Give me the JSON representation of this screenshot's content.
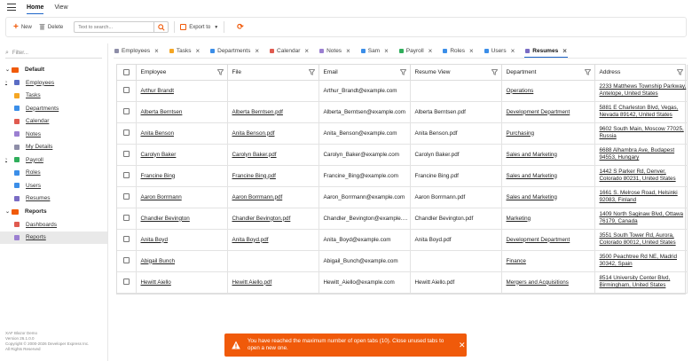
{
  "header": {
    "tabs": [
      {
        "label": "Home",
        "active": true
      },
      {
        "label": "View",
        "active": false
      }
    ]
  },
  "toolbar": {
    "new_label": "New",
    "delete_label": "Delete",
    "search_placeholder": "Text to search...",
    "export_label": "Export to"
  },
  "sidebar": {
    "filter_placeholder": "Filter...",
    "groups": [
      {
        "label": "Default"
      },
      {
        "label": "Reports"
      }
    ],
    "items": [
      {
        "label": "Employees",
        "color": "#5a6cc4",
        "expandable": true
      },
      {
        "label": "Tasks",
        "color": "#f5a623",
        "expandable": false
      },
      {
        "label": "Departments",
        "color": "#3b8ee8",
        "expandable": false
      },
      {
        "label": "Calendar",
        "color": "#e05a4f",
        "expandable": false
      },
      {
        "label": "Notes",
        "color": "#9b7fd1",
        "expandable": false
      },
      {
        "label": "My Details",
        "color": "#8e8ea8",
        "expandable": false
      },
      {
        "label": "Payroll",
        "color": "#2fae5b",
        "expandable": true
      },
      {
        "label": "Roles",
        "color": "#3b8ee8",
        "expandable": false
      },
      {
        "label": "Users",
        "color": "#3b8ee8",
        "expandable": false
      },
      {
        "label": "Resumes",
        "color": "#7a6cc4",
        "expandable": false
      }
    ],
    "report_items": [
      {
        "label": "Dashboards",
        "color": "#e05a4f"
      },
      {
        "label": "Reports",
        "color": "#9b7fd1"
      }
    ],
    "footer": [
      "XAF Blazor Demo",
      "Version 26.1.0.0",
      "Copyright © 2000-2026 Developer Express Inc.",
      "All Rights Reserved"
    ]
  },
  "tabs": [
    {
      "label": "Employees",
      "color": "#8e8ea8",
      "active": false
    },
    {
      "label": "Tasks",
      "color": "#f5a623",
      "active": false
    },
    {
      "label": "Departments",
      "color": "#3b8ee8",
      "active": false
    },
    {
      "label": "Calendar",
      "color": "#e05a4f",
      "active": false
    },
    {
      "label": "Notes",
      "color": "#9b7fd1",
      "active": false
    },
    {
      "label": "Sam",
      "color": "#3b8ee8",
      "active": false
    },
    {
      "label": "Payroll",
      "color": "#2fae5b",
      "active": false
    },
    {
      "label": "Roles",
      "color": "#3b8ee8",
      "active": false
    },
    {
      "label": "Users",
      "color": "#3b8ee8",
      "active": false
    },
    {
      "label": "Resumes",
      "color": "#7a6cc4",
      "active": true
    }
  ],
  "grid": {
    "columns": [
      "Employee",
      "File",
      "Email",
      "Resume View",
      "Department",
      "Address"
    ],
    "rows": [
      [
        "Arthur Brandt",
        "",
        "Arthur_Brandt@example.com",
        "",
        "Operations",
        "2233 Matthews Township Parkway, Antelope, United States"
      ],
      [
        "Alberta Berntsen",
        "Alberta Berntsen.pdf",
        "Alberta_Berntsen@example.com",
        "Alberta Berntsen.pdf",
        "Development Department",
        "5881 E Charleston Blvd, Vegas, Nevada 89142, United States"
      ],
      [
        "Anita Benson",
        "Anita Benson.pdf",
        "Anita_Benson@example.com",
        "Anita Benson.pdf",
        "Purchasing",
        "9602 South Main, Moscow 77025, Russia"
      ],
      [
        "Carolyn Baker",
        "Carolyn Baker.pdf",
        "Carolyn_Baker@example.com",
        "Carolyn Baker.pdf",
        "Sales and Marketing",
        "6688 Alhambra Ave, Budapest 94553, Hungary"
      ],
      [
        "Francine Bing",
        "Francine Bing.pdf",
        "Francine_Bing@example.com",
        "Francine Bing.pdf",
        "Sales and Marketing",
        "1442 S Parker Rd, Denver, Colorado 80231, United States"
      ],
      [
        "Aaron Borrmann",
        "Aaron Borrmann.pdf",
        "Aaron_Borrmann@example.com",
        "Aaron Borrmann.pdf",
        "Sales and Marketing",
        "1661 S. Melrose Road, Helsinki 92083, Finland"
      ],
      [
        "Chandler Bevington",
        "Chandler Bevington.pdf",
        "Chandler_Bevington@example.com",
        "Chandler Bevington.pdf",
        "Marketing",
        "1409 North Saginaw Blvd, Ottawa 76179, Canada"
      ],
      [
        "Anita Boyd",
        "Anita Boyd.pdf",
        "Anita_Boyd@example.com",
        "Anita Boyd.pdf",
        "Development Department",
        "3551 South Tower Rd, Aurora, Colorado 80012, United States"
      ],
      [
        "Abigail Bunch",
        "",
        "Abigail_Bunch@example.com",
        "",
        "Finance",
        "3500 Peachtree Rd NE, Madrid 30342, Spain"
      ],
      [
        "Hewitt Aiello",
        "Hewitt Aiello.pdf",
        "Hewitt_Aiello@example.com",
        "Hewitt Aiello.pdf",
        "Mergers and Acquisitions",
        "8514 University Center Blvd, Birmingham, United States"
      ]
    ]
  },
  "toast": {
    "message": "You have reached the maximum number of open tabs (10). Close unused tabs to open a new one."
  },
  "colors": {
    "accent": "#f05a0a",
    "selection": "#1e65c8"
  }
}
